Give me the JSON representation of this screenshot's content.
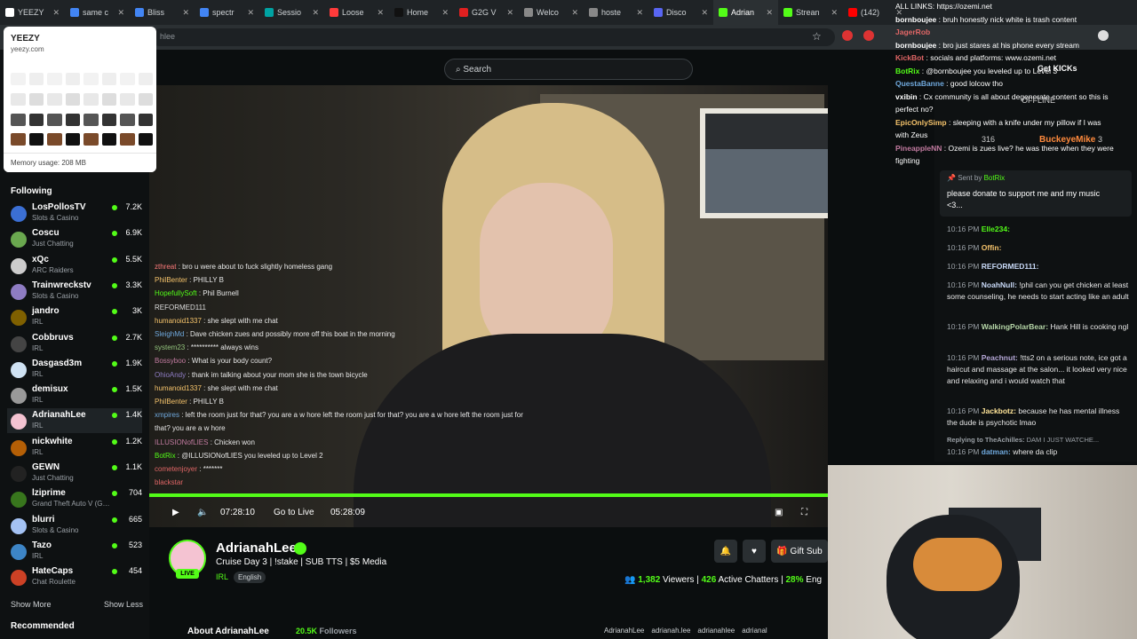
{
  "tabs": [
    {
      "label": "YEEZY",
      "color": "#ffffff"
    },
    {
      "label": "same c",
      "color": "#4285f4"
    },
    {
      "label": "Bliss",
      "color": "#4285f4"
    },
    {
      "label": "spectr",
      "color": "#4285f4"
    },
    {
      "label": "Sessio",
      "color": "#00a3a3"
    },
    {
      "label": "Loose",
      "color": "#ff3b3b"
    },
    {
      "label": "Home",
      "color": "#111111"
    },
    {
      "label": "G2G V",
      "color": "#e02020"
    },
    {
      "label": "Welco",
      "color": "#888888"
    },
    {
      "label": "hoste",
      "color": "#888888"
    },
    {
      "label": "Disco",
      "color": "#5865f2"
    },
    {
      "label": "Adrian",
      "color": "#53fc18"
    },
    {
      "label": "Strean",
      "color": "#53fc18"
    },
    {
      "label": "(142)",
      "color": "#ff0000"
    }
  ],
  "address_fragment": "hlee",
  "hover_card": {
    "title": "YEEZY",
    "url": "yeezy.com",
    "memory": "Memory usage: 208 MB"
  },
  "search_placeholder": "Search",
  "sidebar": {
    "following_label": "Following",
    "channels": [
      {
        "name": "LosPollosTV",
        "category": "Slots & Casino",
        "viewers": "7.2K",
        "color": "#3b6fd4"
      },
      {
        "name": "Coscu",
        "category": "Just Chatting",
        "viewers": "6.9K",
        "color": "#6aa84f"
      },
      {
        "name": "xQc",
        "category": "ARC Raiders",
        "viewers": "5.5K",
        "color": "#cccccc"
      },
      {
        "name": "Trainwreckstv",
        "category": "Slots & Casino",
        "viewers": "3.3K",
        "color": "#8e7cc3"
      },
      {
        "name": "jandro",
        "category": "IRL",
        "viewers": "3K",
        "color": "#7f6000"
      },
      {
        "name": "Cobbruvs",
        "category": "IRL",
        "viewers": "2.7K",
        "color": "#444444"
      },
      {
        "name": "Dasgasd3m",
        "category": "IRL",
        "viewers": "1.9K",
        "color": "#cfe2f3"
      },
      {
        "name": "demisux",
        "category": "IRL",
        "viewers": "1.5K",
        "color": "#999999"
      },
      {
        "name": "AdrianahLee",
        "category": "IRL",
        "viewers": "1.4K",
        "color": "#f4c3d2"
      },
      {
        "name": "nickwhite",
        "category": "IRL",
        "viewers": "1.2K",
        "color": "#b45f06"
      },
      {
        "name": "GEWN",
        "category": "Just Chatting",
        "viewers": "1.1K",
        "color": "#222222"
      },
      {
        "name": "lziprime",
        "category": "Grand Theft Auto V (G…",
        "viewers": "704",
        "color": "#38761d"
      },
      {
        "name": "blurri",
        "category": "Slots & Casino",
        "viewers": "665",
        "color": "#a4c2f4"
      },
      {
        "name": "Tazo",
        "category": "IRL",
        "viewers": "523",
        "color": "#3d85c6"
      },
      {
        "name": "HateCaps",
        "category": "Chat Roulette",
        "viewers": "454",
        "color": "#cc4125"
      }
    ],
    "show_more": "Show More",
    "show_less": "Show Less",
    "recommended_label": "Recommended"
  },
  "video_chat": [
    {
      "user": "zthreat",
      "text": "bro u were about to fuck slightly homeless gang",
      "color": "#ff7b7b"
    },
    {
      "user": "PhilBenter",
      "text": "PHILLY B",
      "color": "#f5c36b"
    },
    {
      "user": "HopefullySoft",
      "text": "Phil Burnell",
      "color": "#53fc18"
    },
    {
      "user": "REFORMED111",
      "text": "",
      "color": "#dddddd"
    },
    {
      "user": "humanoid1337",
      "text": "she slept with me chat",
      "color": "#f5c36b"
    },
    {
      "user": "SleighMd",
      "text": "Dave chicken zues and possibly more off this boat in the morning",
      "color": "#6fa8dc"
    },
    {
      "user": "system23",
      "text": "********** always wins",
      "color": "#93c47d"
    },
    {
      "user": "Bossyboo",
      "text": "What is your body count?",
      "color": "#c27ba0"
    },
    {
      "user": "OhioAndy",
      "text": "thank im talking about your mom she is the town bicycle",
      "color": "#8e7cc3"
    },
    {
      "user": "humanoid1337",
      "text": "she slept with me chat",
      "color": "#f5c36b"
    },
    {
      "user": "PhilBenter",
      "text": "PHILLY B",
      "color": "#f5c36b"
    },
    {
      "user": "xmpires",
      "text": "left the room just for that? you are a w hore left the room just for that? you are a w hore left the room just for",
      "color": "#6fa8dc"
    },
    {
      "user": "",
      "text": "that? you are a w hore",
      "color": "#ffffff"
    },
    {
      "user": "ILLUSIONofLIES",
      "text": "Chicken won",
      "color": "#c27ba0"
    },
    {
      "user": "BotRix",
      "text": "@ILLUSIONofLIES you leveled up to Level 2",
      "color": "#53fc18"
    },
    {
      "user": "cometenjoyer",
      "text": "*******",
      "color": "#e06666"
    },
    {
      "user": "blackstar",
      "text": "",
      "color": "#e06666"
    }
  ],
  "player": {
    "elapsed": "07:28:10",
    "go_live": "Go to Live",
    "duration": "05:28:09",
    "progress_pct": 100
  },
  "channel": {
    "name": "AdrianahLee",
    "title": "Cruise Day 3 | !stake | SUB TTS | $5 Media",
    "category": "IRL",
    "language": "English",
    "live": "LIVE",
    "viewers": "1,382",
    "viewers_label": "Viewers",
    "chatters": "426",
    "chatters_label": "Active Chatters",
    "eng_pct": "28%",
    "eng_label": "Eng",
    "gift": "Gift Sub",
    "about": "About AdrianahLee",
    "followers": "20.5K",
    "followers_label": "Followers",
    "socials": [
      "AdrianahLee",
      "adrianah.lee",
      "adrianahlee",
      "adrianal"
    ]
  },
  "overlay_chat": [
    {
      "user": "",
      "text": "ALL LINKS: https://ozemi.net",
      "color": "#ffffff"
    },
    {
      "user": "bornboujee",
      "text": "bruh honestly nick white is trash content",
      "color": "#ffffff"
    },
    {
      "user": "JagerRob",
      "text": "",
      "color": "#e06666"
    },
    {
      "user": "bornboujee",
      "text": "bro just stares at his phone every stream",
      "color": "#ffffff"
    },
    {
      "user": "KickBot",
      "text": "socials and platforms: www.ozemi.net",
      "color": "#e06666"
    },
    {
      "user": "BotRix",
      "text": "@bornboujee you leveled up to Level 3",
      "color": "#53fc18"
    },
    {
      "user": "QuestaBanne",
      "text": "good lolcow tho",
      "color": "#6fa8dc"
    },
    {
      "user": "vxibin",
      "text": "Cx community is all about degenerate content so this is",
      "color": "#ffffff"
    },
    {
      "user": "",
      "text": "perfect no?",
      "color": "#ffffff"
    },
    {
      "user": "EpicOnlySimp",
      "text": "sleeping with a knife under my pillow if I was",
      "color": "#f5c36b"
    },
    {
      "user": "",
      "text": "with Zeus",
      "color": "#ffffff"
    },
    {
      "user": "PineappleNN",
      "text": "Ozemi is zues live? he was there when they were",
      "color": "#c27ba0"
    },
    {
      "user": "",
      "text": "fighting",
      "color": "#ffffff"
    }
  ],
  "chat_top": {
    "get_kicks": "Get KICKs",
    "offline": "OFFLINE",
    "count": "316",
    "buckeye": "BuckeyeMike",
    "buckeye_count": "3"
  },
  "pinned": {
    "sent_by": "Sent by",
    "bot": "BotRix",
    "text": "please donate to support me and my music <3..."
  },
  "chat": [
    {
      "time": "10:16 PM",
      "user": "Elle234:",
      "text": "",
      "color": "#53fc18"
    },
    {
      "time": "10:16 PM",
      "user": "Offin:",
      "text": "",
      "color": "#f5c36b"
    },
    {
      "time": "10:16 PM",
      "user": "REFORMED111:",
      "text": "",
      "color": "#c9daf8"
    },
    {
      "time": "10:16 PM",
      "user": "NoahNull:",
      "text": "!phil can you get chicken at least some counseling, he needs to start acting like an adult",
      "color": "#c9daf8"
    },
    {
      "time": "10:16 PM",
      "user": "WalkingPolarBear:",
      "text": "Hank Hill is cooking ngl",
      "color": "#b6d7a8"
    },
    {
      "time": "10:16 PM",
      "user": "Peachnut:",
      "text": "!tts2 on a serious note, ice got a haircut and massage at the salon... it looked very nice and relaxing and i would watch that",
      "color": "#b4a7d6"
    },
    {
      "time": "10:16 PM",
      "user": "Jackbotz:",
      "text": "because he has mental illness the dude is psychotic lmao",
      "color": "#ffe599"
    },
    {
      "time": "",
      "user": "Replying to TheAchilles:",
      "text": "DAM I JUST WATCHE...",
      "color": "#9aa0a6"
    },
    {
      "time": "10:16 PM",
      "user": "datman:",
      "text": "where da clip",
      "color": "#6fa8dc"
    }
  ]
}
